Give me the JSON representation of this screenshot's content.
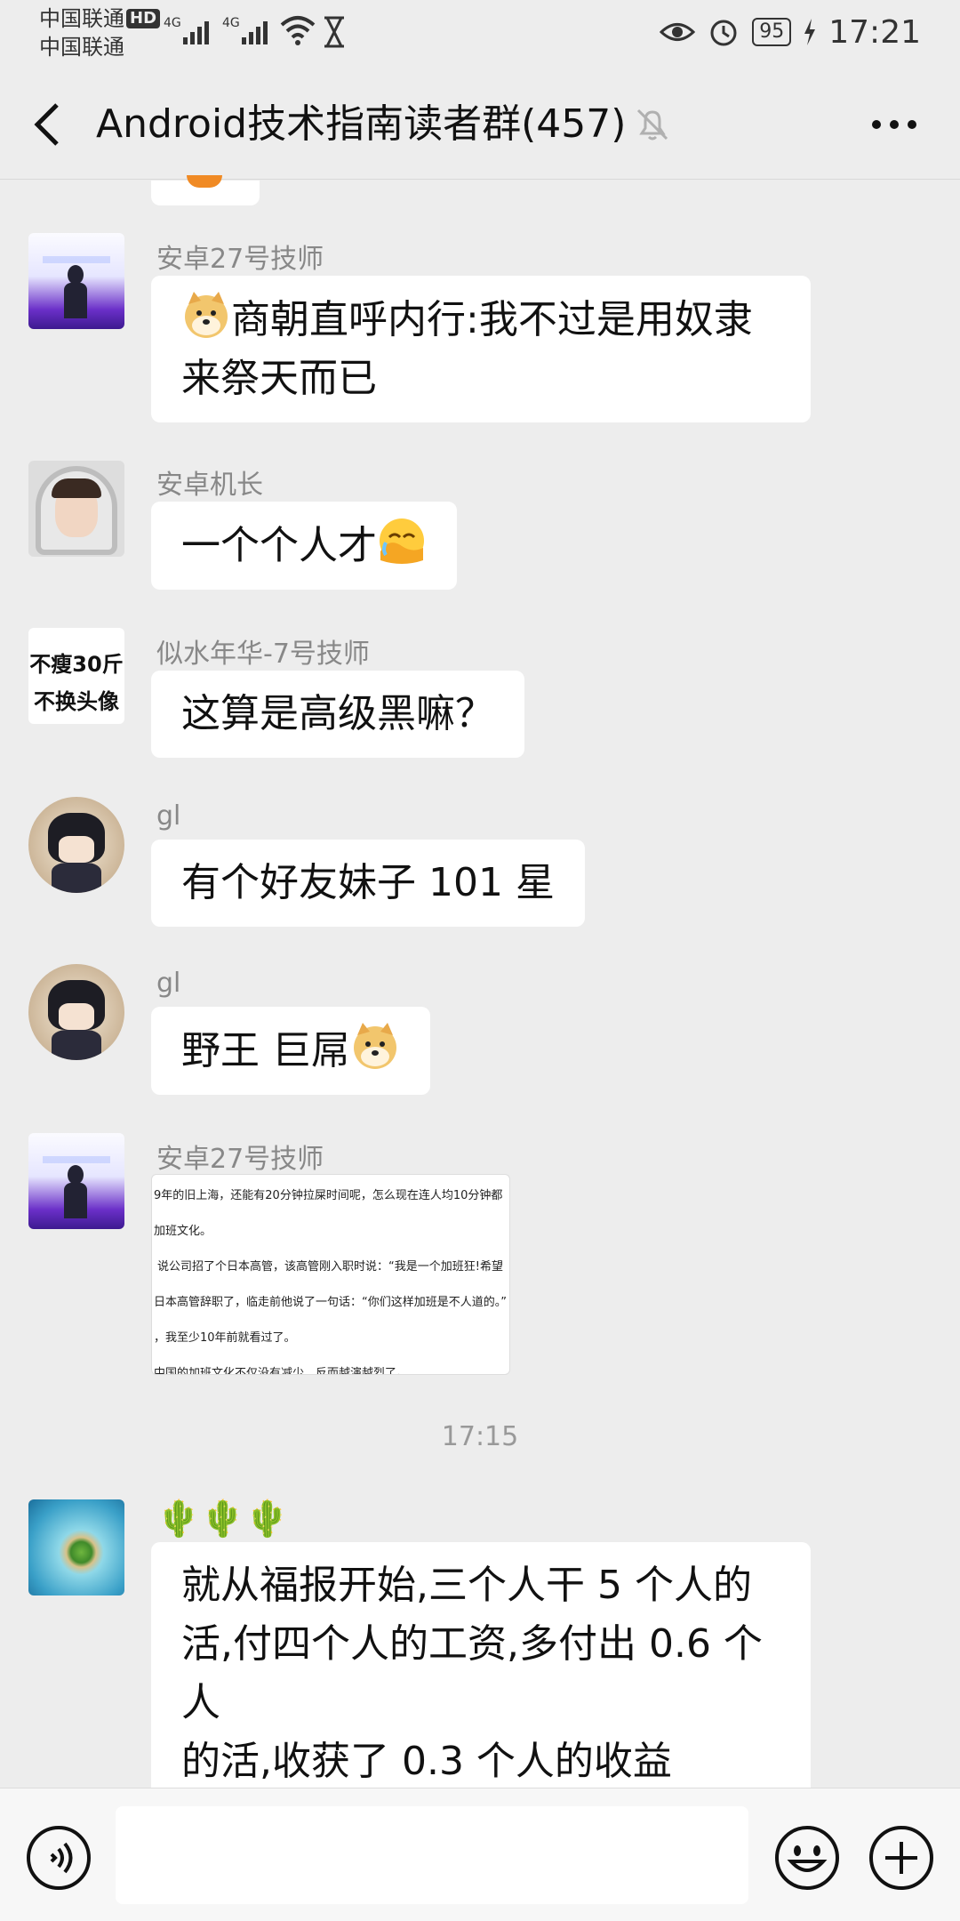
{
  "status_bar": {
    "carrier_1": "中国联通",
    "carrier_2": "中国联通",
    "hd": "HD",
    "signal_1": "4G",
    "signal_2": "4G",
    "battery": "95",
    "time": "17:21"
  },
  "header": {
    "title": "Android技术指南读者群(457)"
  },
  "messages": [
    {
      "sender": "安卓27号技师",
      "text": "商朝直呼内行:我不过是用奴隶来祭天而已",
      "line1": "商朝直呼内行:我不过是用奴隶",
      "line2": "来祭天而已"
    },
    {
      "sender": "安卓机长",
      "text": "一个个人才"
    },
    {
      "sender": "似水年华-7号技师",
      "avatar_text_1": "不瘦30斤",
      "avatar_text_2": "不换头像",
      "text": "这算是高级黑嘛？"
    },
    {
      "sender": "gl",
      "text": "有个好友妹子 101 星"
    },
    {
      "sender": "gl",
      "text": "野王 巨屌"
    },
    {
      "sender": "安卓27号技师",
      "image_lines": [
        "9年的旧上海，还能有20分钟拉屎时间呢，怎么现在连人均10分钟都",
        "加班文化。",
        "说公司招了个日本高管，该高管刚入职时说：“我是一个加班狂!希望",
        "日本高管辞职了，临走前他说了一句话：“你们这样加班是不人道的。”",
        "，我至少10年前就看过了。",
        "中国的加班文化不仅没有减少，反而越演越烈了。"
      ]
    },
    {
      "time": "17:15"
    },
    {
      "sender": "🌵🌵🌵",
      "text": "就从福报开始,三个人干 5 个人的活,付四个人的工资,多付出 0.6 个人的活,收获了 0.3 个人的收益",
      "line1": "就从福报开始,三个人干 5 个人的",
      "line2": "活,付四个人的工资,多付出 0.6 个人",
      "line3": "的活,收获了 0.3 个人的收益"
    }
  ],
  "input": {
    "value": ""
  },
  "colors": {
    "background": "#ededed",
    "bubble": "#ffffff",
    "sender": "#888888"
  }
}
